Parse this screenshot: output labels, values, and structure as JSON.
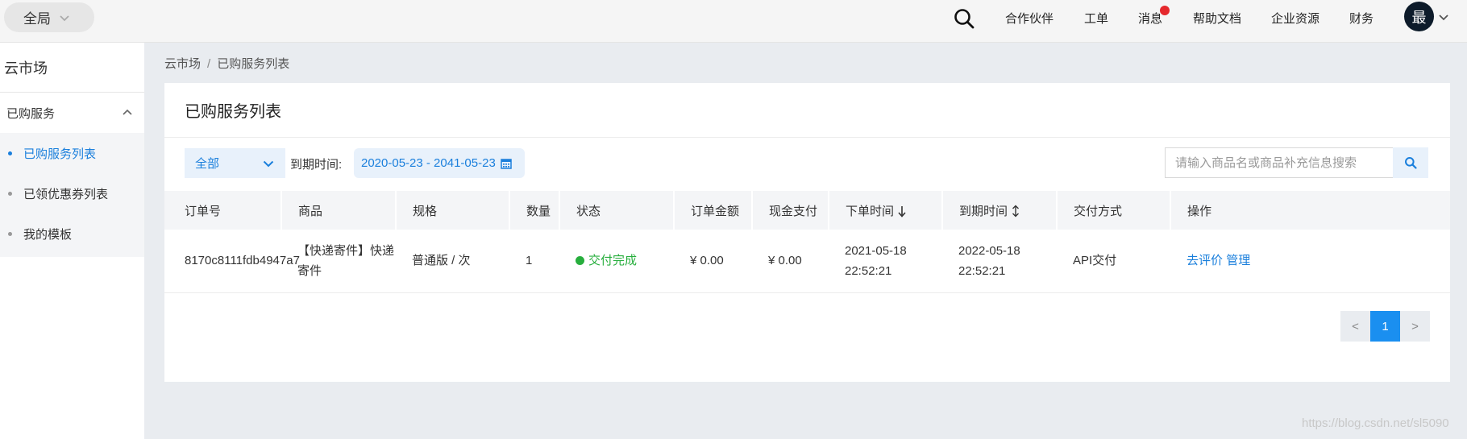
{
  "topbar": {
    "region_label": "全局",
    "nav": [
      "合作伙伴",
      "工单",
      "消息",
      "帮助文档",
      "企业资源",
      "财务"
    ],
    "message_has_badge": true,
    "avatar_text": "最",
    "icons": {
      "search": "search-icon",
      "region": "chevron-down-icon",
      "avatar": "chevron-down-icon"
    }
  },
  "sidebar": {
    "title": "云市场",
    "group_label": "已购服务",
    "items": [
      {
        "label": "已购服务列表",
        "active": true
      },
      {
        "label": "已领优惠券列表",
        "active": false
      },
      {
        "label": "我的模板",
        "active": false
      }
    ]
  },
  "breadcrumb": {
    "root": "云市场",
    "sep": "/",
    "current": "已购服务列表"
  },
  "card": {
    "title": "已购服务列表",
    "filter": {
      "select_value": "全部",
      "date_label": "到期时间:",
      "date_range": "2020-05-23 - 2041-05-23",
      "search_placeholder": "请输入商品名或商品补充信息搜索"
    },
    "table": {
      "headers": [
        "订单号",
        "商品",
        "规格",
        "数量",
        "状态",
        "订单金额",
        "现金支付",
        "下单时间",
        "到期时间",
        "交付方式",
        "操作"
      ],
      "rows": [
        {
          "order_id": "8170c8111fdb4947a7",
          "product": "【快递寄件】快递寄件",
          "spec": "普通版 / 次",
          "qty": "1",
          "status": "交付完成",
          "amount": "¥ 0.00",
          "cash": "¥ 0.00",
          "order_time_date": "2021-05-18",
          "order_time_clock": "22:52:21",
          "expire_date": "2022-05-18",
          "expire_clock": "22:52:21",
          "delivery": "API交付",
          "action_review": "去评价",
          "action_manage": "管理"
        }
      ]
    },
    "pager": {
      "prev": "<",
      "current": "1",
      "next": ">"
    }
  },
  "watermark": "https://blog.csdn.net/sl5090",
  "colors": {
    "accent": "#1a7fdc",
    "success": "#27ae3d",
    "danger": "#e5282d",
    "avatar_bg": "#0d1b2a"
  }
}
